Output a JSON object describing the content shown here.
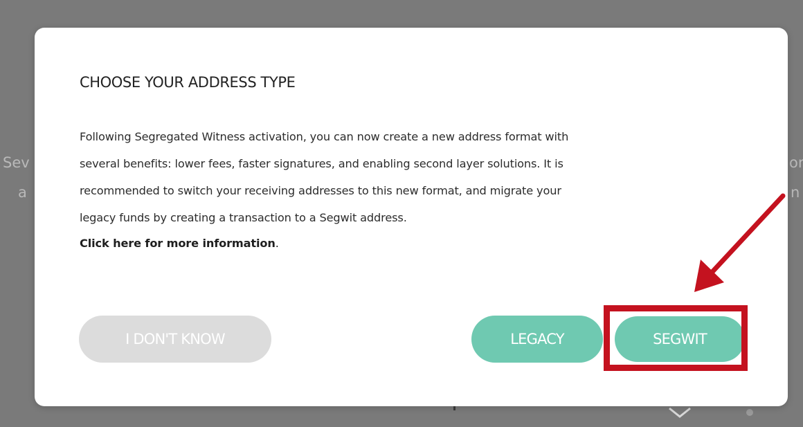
{
  "background": {
    "left_fragments": [
      "Sev",
      "a"
    ],
    "right_fragments": [
      "or",
      "n"
    ]
  },
  "modal": {
    "title": "CHOOSE YOUR ADDRESS TYPE",
    "body_lines": [
      "Following Segregated Witness activation, you can now create a new address format with",
      "several benefits: lower fees, faster signatures, and enabling second layer solutions. It is",
      "recommended to switch your receiving addresses to this new format, and migrate your",
      "legacy funds by creating a transaction to a Segwit address."
    ],
    "more_info_link": "Click here for more information",
    "more_info_suffix": "."
  },
  "buttons": {
    "unknown_label": "I DON'T KNOW",
    "legacy_label": "LEGACY",
    "segwit_label": "SEGWIT"
  },
  "colors": {
    "accent_teal": "#6fc9b1",
    "disabled_gray": "#dcdcdc",
    "annotation_red": "#c4121f",
    "backdrop": "#7a7a7a"
  },
  "icons": {
    "background_icon": "chevron-down-icon"
  }
}
